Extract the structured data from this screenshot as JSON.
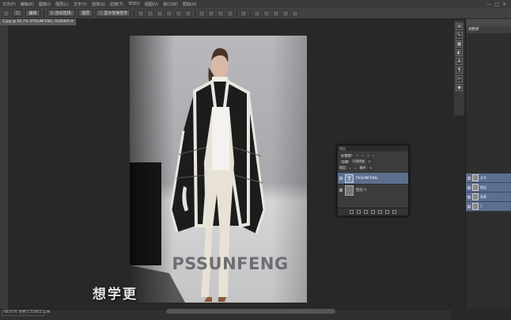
{
  "menubar": {
    "items": [
      "文件(F)",
      "编辑(E)",
      "图像(I)",
      "图层(L)",
      "文字(Y)",
      "选择(S)",
      "滤镜(T)",
      "3D(D)",
      "视图(V)",
      "窗口(W)",
      "帮助(H)"
    ],
    "window_controls": [
      "—",
      "□",
      "✕"
    ]
  },
  "optionsbar": {
    "preset": "☐",
    "mode": "编辑",
    "layer_select": "☑ 自动选择:",
    "target": "图层",
    "show_transform": "☐ 显示变换控件"
  },
  "document": {
    "tab_label": "1.jpg @ 66.7% (PSSUNFENG, RGB/8#) *",
    "close": "×"
  },
  "canvas": {
    "watermark_text": "PSSUNFENG",
    "caption": "想学更"
  },
  "status": {
    "zoom": "66.67%",
    "doc_info": "文档:1.51M/2.13M"
  },
  "icon_strip": {
    "icons": [
      "history-icon",
      "brush-icon",
      "swatch-icon",
      "adjust-icon",
      "text-icon",
      "paragraph-icon",
      "tool-icon",
      "3d-icon"
    ],
    "glyphs": [
      "⊞",
      "✎",
      "▦",
      "◐",
      "A",
      "¶",
      "✂",
      "◉"
    ]
  },
  "right_panel": {
    "header": "",
    "tab": "调整库"
  },
  "side_layers": [
    {
      "label": "文字"
    },
    {
      "label": "图层"
    },
    {
      "label": "背景"
    },
    {
      "label": "1"
    }
  ],
  "layers_panel": {
    "title": "图层",
    "kind": "ρ 类型",
    "blend": "正常",
    "opacity_label": "不透明度:",
    "lock_label": "锁定:",
    "fill_label": "填充:",
    "layers": [
      {
        "name": "PSSUNFENG",
        "type": "text",
        "selected": true
      },
      {
        "name": "图层 0",
        "type": "photo",
        "selected": false
      }
    ]
  },
  "colors": {
    "selection_blue": "#5d6f8f",
    "panel_bg": "#3c3c3c",
    "canvas_bg": "#282828"
  }
}
